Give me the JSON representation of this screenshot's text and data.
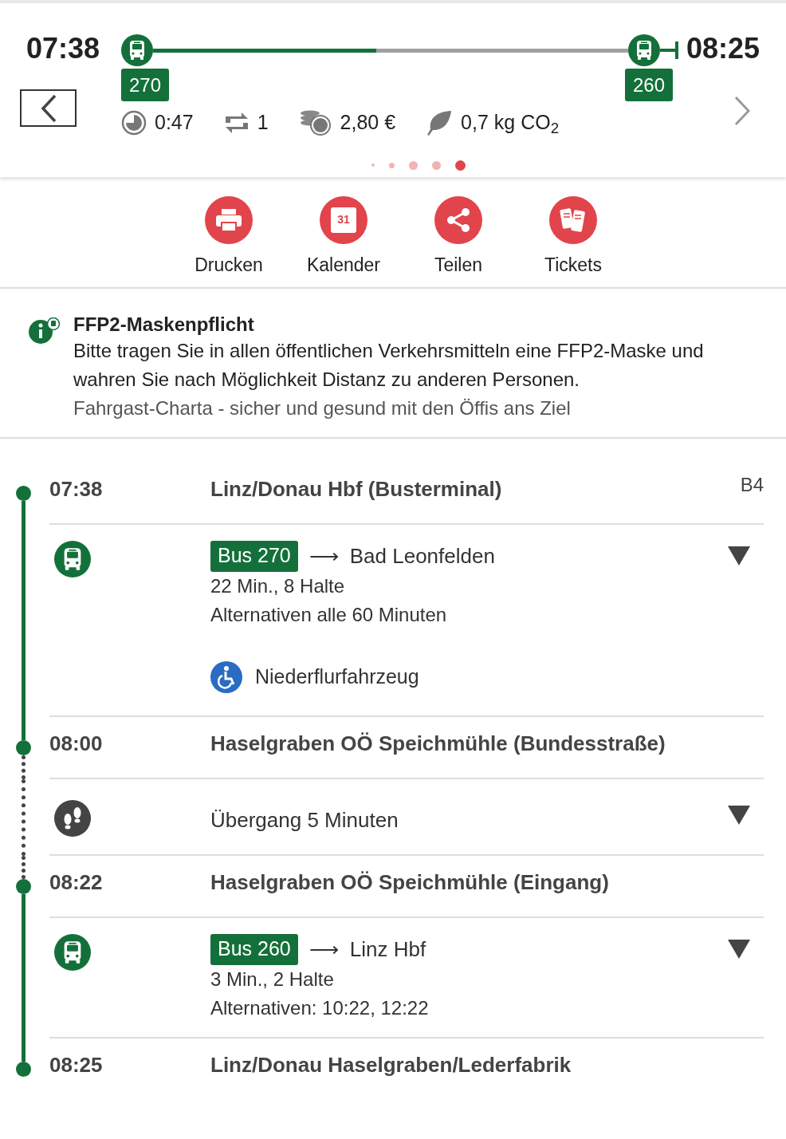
{
  "header": {
    "departure": "07:38",
    "arrival": "08:25",
    "progress": {
      "level": 0.47
    },
    "lines": [
      {
        "label": "270"
      },
      {
        "label": "260"
      }
    ],
    "stats": [
      {
        "kind": "duration",
        "text": "0:47"
      },
      {
        "kind": "transfers",
        "text": "1"
      },
      {
        "kind": "price",
        "text": "2,80 €"
      },
      {
        "kind": "co2",
        "text": "0,7 kg CO$_{2}$"
      }
    ],
    "pages": [
      {
        "selected": false
      },
      {
        "selected": false
      },
      {
        "selected": false
      },
      {
        "selected": false
      },
      {
        "selected": true
      }
    ]
  },
  "actions": [
    {
      "kind": "print",
      "label": "Drucken"
    },
    {
      "kind": "calendar",
      "label": "Kalender",
      "day": "31"
    },
    {
      "kind": "share",
      "label": "Teilen"
    },
    {
      "kind": "tickets",
      "label": "Tickets"
    }
  ],
  "notice": {
    "title": "FFP2-Maskenpflicht",
    "text": "Bitte tragen Sie in allen öffentlichen Verkehrsmitteln eine FFP2-Maske und wahren Sie nach Möglichkeit Distanz zu anderen Personen.",
    "link": "Fahrgast-Charta - sicher und gesund mit den Öffis ans Ziel"
  },
  "itinerary": [
    {
      "kind": "stop",
      "time": "07:38",
      "name": "Linz/Donau Hbf (Busterminal)",
      "platform": "B4"
    },
    {
      "kind": "bus",
      "line": "Bus 270",
      "arrow": "⟶",
      "destination": "Bad Leonfelden",
      "info": [
        "22 Min., 8 Halte",
        "Alternativen alle 60 Minuten"
      ],
      "feature": "Niederflurfahrzeug"
    },
    {
      "kind": "stop",
      "time": "08:00",
      "name": "Haselgraben OÖ Speichmühle (Bundesstraße)"
    },
    {
      "kind": "walk",
      "text": "Übergang 5 Minuten"
    },
    {
      "kind": "stop",
      "time": "08:22",
      "name": "Haselgraben OÖ Speichmühle (Eingang)"
    },
    {
      "kind": "bus",
      "line": "Bus 260",
      "arrow": "⟶",
      "destination": "Linz Hbf",
      "info": [
        "3 Min., 2 Halte",
        "Alternativen: 10:22, 12:22"
      ]
    },
    {
      "kind": "stop",
      "time": "08:25",
      "name": "Linz/Donau Haselgraben/Lederfabrik"
    }
  ]
}
